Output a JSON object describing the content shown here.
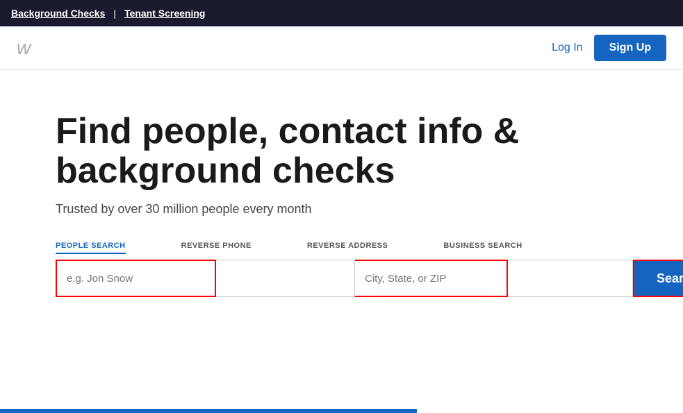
{
  "topbar": {
    "background_checks_label": "Background Checks",
    "tenant_screening_label": "Tenant Screening",
    "divider": "|"
  },
  "header": {
    "logo": "w",
    "login_label": "Log In",
    "signup_label": "Sign Up"
  },
  "hero": {
    "title": "Find people, contact info & background checks",
    "subtitle": "Trusted by over 30 million people every month"
  },
  "search": {
    "tabs": [
      {
        "id": "people",
        "label": "PEOPLE SEARCH",
        "active": true
      },
      {
        "id": "phone",
        "label": "REVERSE PHONE",
        "active": false
      },
      {
        "id": "address",
        "label": "REVERSE ADDRESS",
        "active": false
      },
      {
        "id": "business",
        "label": "BUSINESS SEARCH",
        "active": false
      }
    ],
    "name_placeholder": "e.g. Jon Snow",
    "name_value": "Jon Snow",
    "phone_placeholder": "",
    "city_placeholder": "City, State, or ZIP",
    "business_placeholder": "",
    "search_button_label": "Search"
  }
}
